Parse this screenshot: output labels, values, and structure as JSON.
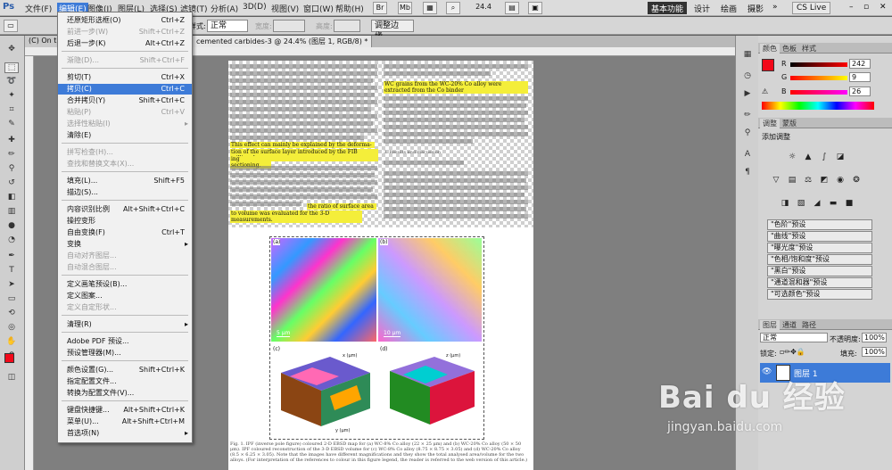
{
  "menubar": {
    "logo": "Ps",
    "items": [
      "文件(F)",
      "编辑(E)",
      "图像(I)",
      "图层(L)",
      "选择(S)",
      "滤镜(T)",
      "分析(A)",
      "3D(D)",
      "视图(V)",
      "窗口(W)",
      "帮助(H)"
    ],
    "zoom": "24.4",
    "workspace": [
      "基本功能",
      "设计",
      "绘画",
      "摄影"
    ],
    "cslive": "CS Live"
  },
  "options": {
    "feather_label": "羽化:",
    "feather_value": "0 px",
    "antialias": "消除锯齿",
    "style_label": "样式:",
    "style_value": "正常",
    "width_label": "宽度:",
    "height_label": "高度:",
    "refine": "调整边缘..."
  },
  "tabs": {
    "tab1": "(C) On th",
    "tab2": "cemented carbides-3 @ 24.4% (图层 1, RGB/8) *"
  },
  "edit_menu": [
    {
      "label": "还原矩形选框(O)",
      "shortcut": "Ctrl+Z",
      "dis": false
    },
    {
      "label": "前进一步(W)",
      "shortcut": "Shift+Ctrl+Z",
      "dis": true
    },
    {
      "label": "后退一步(K)",
      "shortcut": "Alt+Ctrl+Z",
      "dis": false
    },
    {
      "label": "渐隐(D)...",
      "shortcut": "Shift+Ctrl+F",
      "dis": true
    },
    {
      "label": "剪切(T)",
      "shortcut": "Ctrl+X",
      "dis": false
    },
    {
      "label": "拷贝(C)",
      "shortcut": "Ctrl+C",
      "dis": false,
      "sel": true
    },
    {
      "label": "合并拷贝(Y)",
      "shortcut": "Shift+Ctrl+C",
      "dis": false
    },
    {
      "label": "粘贴(P)",
      "shortcut": "Ctrl+V",
      "dis": true
    },
    {
      "label": "选择性粘贴(I)",
      "shortcut": "",
      "dis": true,
      "sub": true
    },
    {
      "label": "清除(E)",
      "shortcut": "",
      "dis": false
    },
    {
      "label": "拼写检查(H)...",
      "shortcut": "",
      "dis": true
    },
    {
      "label": "查找和替换文本(X)...",
      "shortcut": "",
      "dis": true
    },
    {
      "label": "填充(L)...",
      "shortcut": "Shift+F5",
      "dis": false
    },
    {
      "label": "描边(S)...",
      "shortcut": "",
      "dis": false
    },
    {
      "label": "内容识别比例",
      "shortcut": "Alt+Shift+Ctrl+C",
      "dis": false
    },
    {
      "label": "操控变形",
      "shortcut": "",
      "dis": false
    },
    {
      "label": "自由变换(F)",
      "shortcut": "Ctrl+T",
      "dis": false
    },
    {
      "label": "变换",
      "shortcut": "",
      "dis": false,
      "sub": true
    },
    {
      "label": "自动对齐图层...",
      "shortcut": "",
      "dis": true
    },
    {
      "label": "自动混合图层...",
      "shortcut": "",
      "dis": true
    },
    {
      "label": "定义画笔预设(B)...",
      "shortcut": "",
      "dis": false
    },
    {
      "label": "定义图案...",
      "shortcut": "",
      "dis": false
    },
    {
      "label": "定义自定形状...",
      "shortcut": "",
      "dis": true
    },
    {
      "label": "清理(R)",
      "shortcut": "",
      "dis": false,
      "sub": true
    },
    {
      "label": "Adobe PDF 预设...",
      "shortcut": "",
      "dis": false
    },
    {
      "label": "预设管理器(M)...",
      "shortcut": "",
      "dis": false
    },
    {
      "label": "颜色设置(G)...",
      "shortcut": "Shift+Ctrl+K",
      "dis": false
    },
    {
      "label": "指定配置文件...",
      "shortcut": "",
      "dis": false
    },
    {
      "label": "转换为配置文件(V)...",
      "shortcut": "",
      "dis": false
    },
    {
      "label": "键盘快捷键...",
      "shortcut": "Alt+Shift+Ctrl+K",
      "dis": false
    },
    {
      "label": "菜单(U)...",
      "shortcut": "Alt+Shift+Ctrl+M",
      "dis": false
    },
    {
      "label": "首选项(N)",
      "shortcut": "",
      "dis": false,
      "sub": true
    }
  ],
  "doc_text": {
    "hl1": "WC grains from the WC-20% Co alloy were extracted from the Co binder",
    "hl2a": "This effect can mainly be explained by the deforma-",
    "hl2b": "tion of the surface layer introduced by the FIB milling dur-",
    "hl2c": "ing sectioning.",
    "hl3a": "the ratio of surface area",
    "hl3b": "to volume was evaluated for the 3-D measurements.",
    "results": "3. Results and discussion",
    "fig_a": "(a)",
    "fig_b": "(b)",
    "fig_c": "(c)",
    "fig_d": "(d)",
    "scale_a": "5 μm",
    "scale_b": "10 μm",
    "caption": "Fig. 1. IPF (inverse pole figure) coloured 2-D EBSD map for (a) WC-8% Co alloy (22 × 25 μm) and (b) WC-20% Co alloy (50 × 50 μm). IPF coloured reconstruction of the 3-D EBSD volume for (c) WC-8% Co alloy (8.75 × 8.75 × 3.05) and (d) WC-20% Co alloy (8.5 × 6.25 × 3.05). Note that the images have different magnifications and they show the total analysed area/volume for the two alloys. (For interpretation of the references to colour in this figure legend, the reader is referred to the web version of this article.)",
    "axis_x": "x (μm)",
    "axis_y": "y (μm)",
    "axis_z": "z (μm)"
  },
  "color_panel": {
    "tabs": [
      "颜色",
      "色板",
      "样式"
    ],
    "r_label": "R",
    "g_label": "G",
    "b_label": "B",
    "r": "242",
    "g": "9",
    "b": "26",
    "fg": "#f2091a"
  },
  "adjust_panel": {
    "tabs": [
      "调整",
      "蒙版"
    ],
    "title": "添加调整",
    "presets": [
      "\"色阶\"预设",
      "\"曲线\"预设",
      "\"曝光度\"预设",
      "\"色相/饱和度\"预设",
      "\"黑白\"预设",
      "\"通道混和器\"预设",
      "\"可选颜色\"预设"
    ]
  },
  "layers_panel": {
    "tabs": [
      "图层",
      "通道",
      "路径"
    ],
    "blend": "正常",
    "opacity_label": "不透明度:",
    "opacity": "100%",
    "lock_label": "锁定:",
    "fill_label": "填充:",
    "fill": "100%",
    "layer_name": "图层 1"
  },
  "watermark": {
    "text": "Bai du 经验",
    "url": "jingyan.baidu.com"
  }
}
